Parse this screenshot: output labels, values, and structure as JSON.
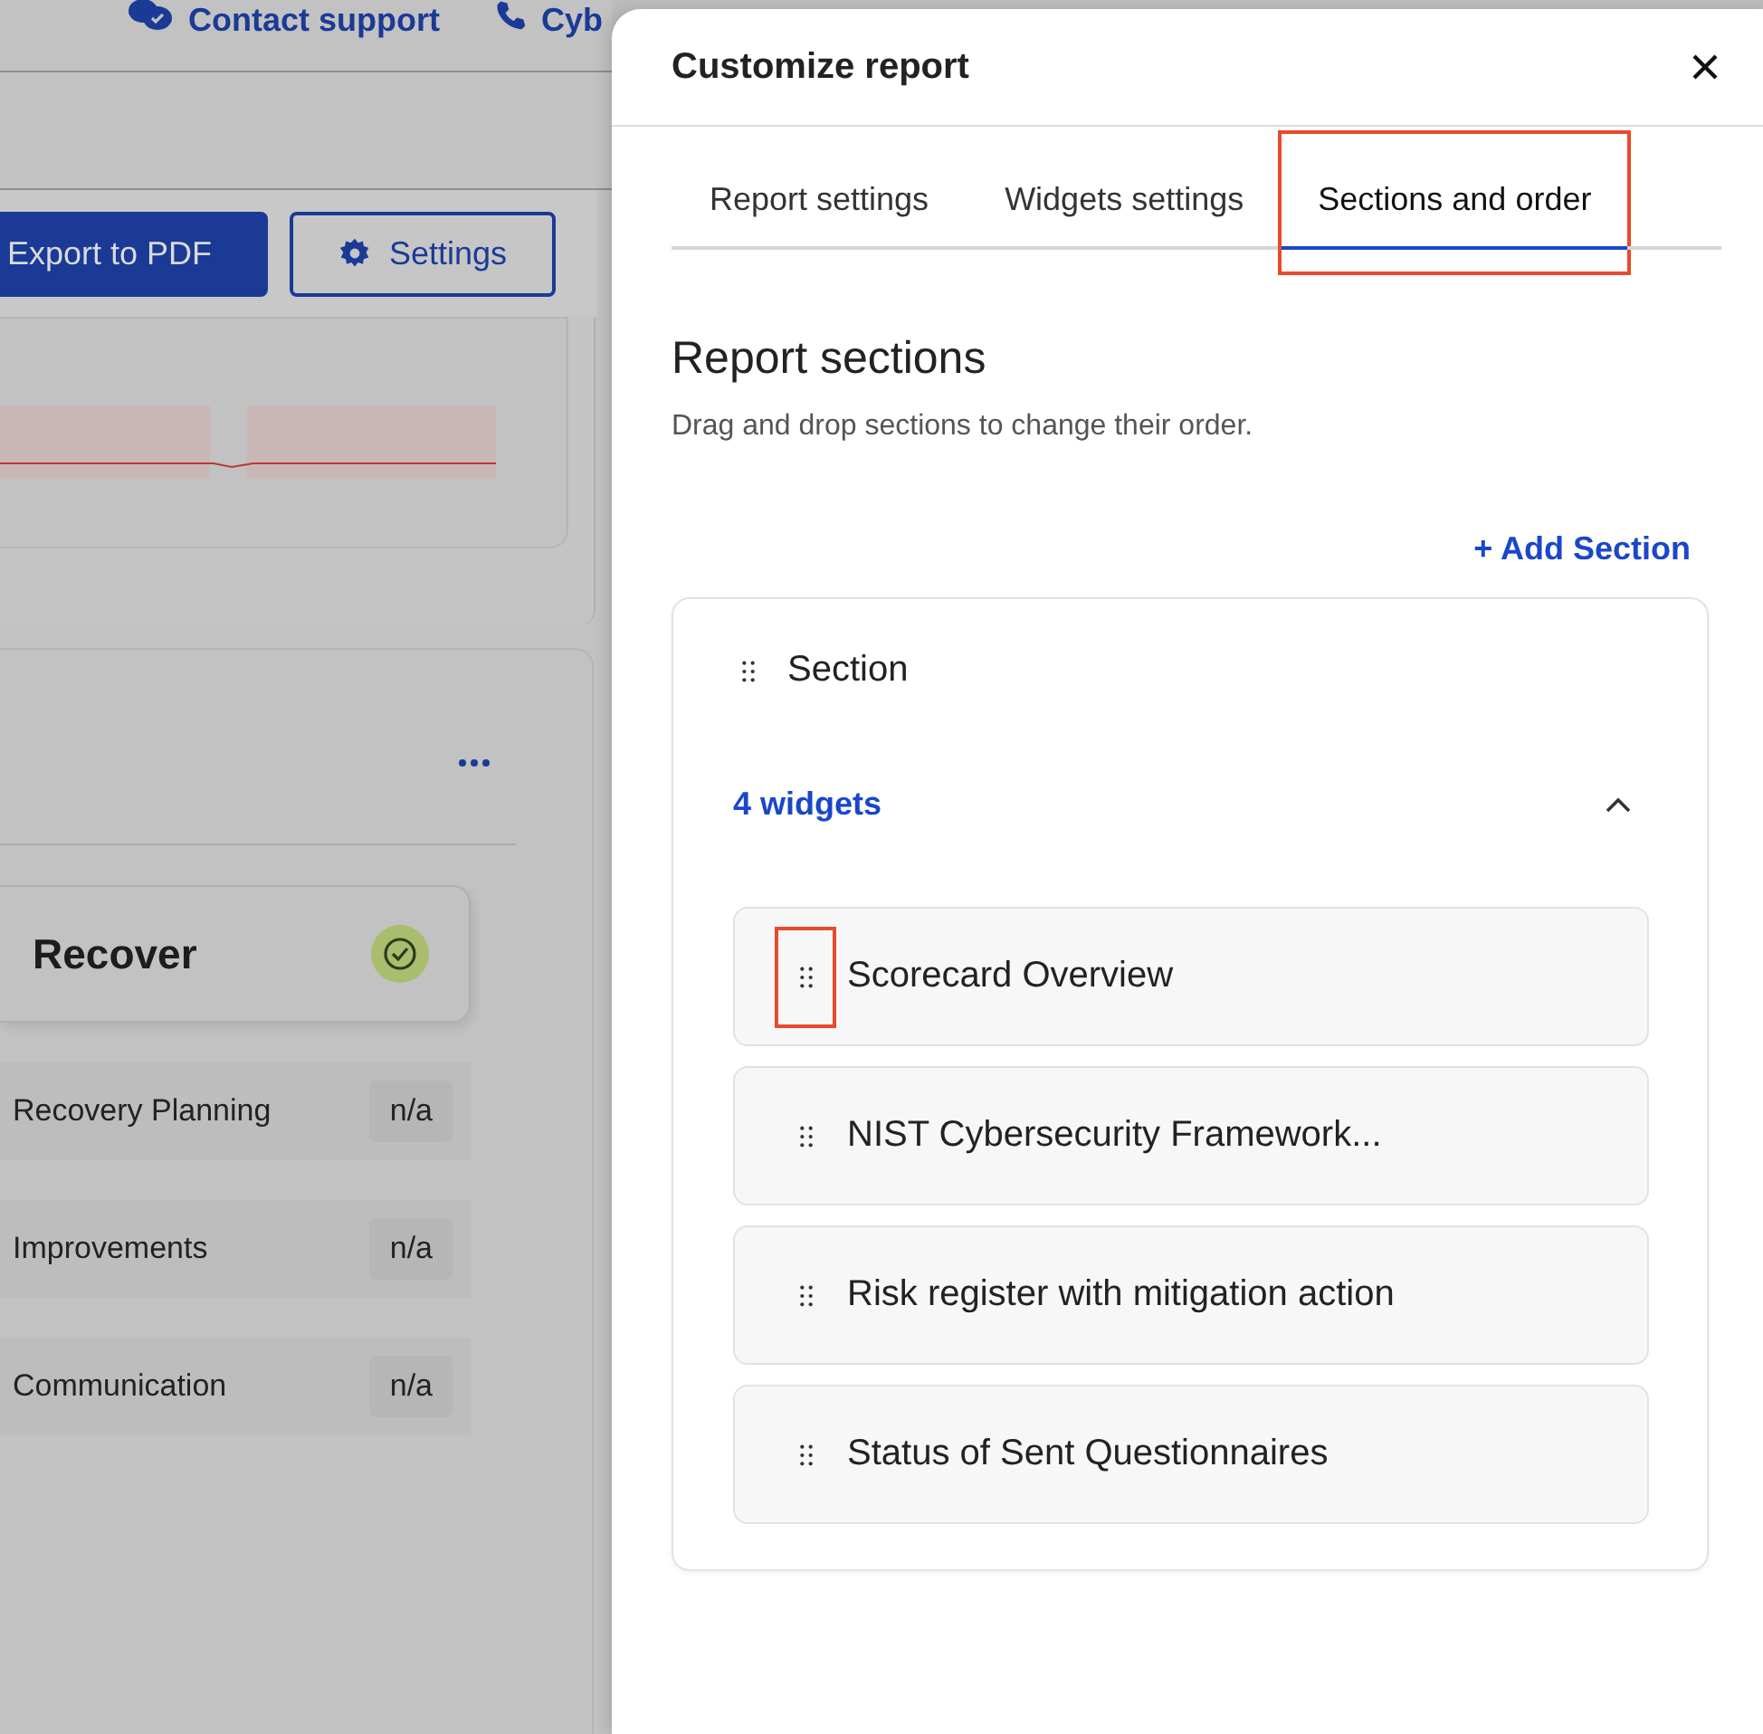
{
  "topbar": {
    "links": [
      {
        "label": "Contact support",
        "kind": "chat"
      },
      {
        "label": "Cyb",
        "kind": "phone"
      }
    ]
  },
  "toolbar": {
    "buttons": [
      {
        "label": "Export to PDF",
        "kind": "primary"
      },
      {
        "label": "Settings",
        "kind": "outline"
      }
    ]
  },
  "recover_card": {
    "title": "Recover",
    "done": true
  },
  "categories": [
    {
      "name": "Recovery Planning",
      "score": "n/a"
    },
    {
      "name": "Improvements",
      "score": "n/a"
    },
    {
      "name": "Communication",
      "score": "n/a"
    }
  ],
  "drawer": {
    "title": "Customize report",
    "tabs": [
      {
        "label": "Report settings",
        "selected": false,
        "highlighted": false
      },
      {
        "label": "Widgets settings",
        "selected": false,
        "highlighted": false
      },
      {
        "label": "Sections and order",
        "selected": true,
        "highlighted": true
      }
    ],
    "heading": "Report sections",
    "hint": "Drag and drop sections to change their order.",
    "add_button": "+ Add Section",
    "section": {
      "title": "Section",
      "widget_count": "4 widgets",
      "expanded": true,
      "widgets": [
        {
          "name": "Scorecard Overview",
          "highlighted": true
        },
        {
          "name": "NIST Cybersecurity Framework...",
          "highlighted": false
        },
        {
          "name": "Risk register with mitigation action",
          "highlighted": false
        },
        {
          "name": "Status of Sent Questionnaires",
          "highlighted": false
        }
      ]
    }
  }
}
